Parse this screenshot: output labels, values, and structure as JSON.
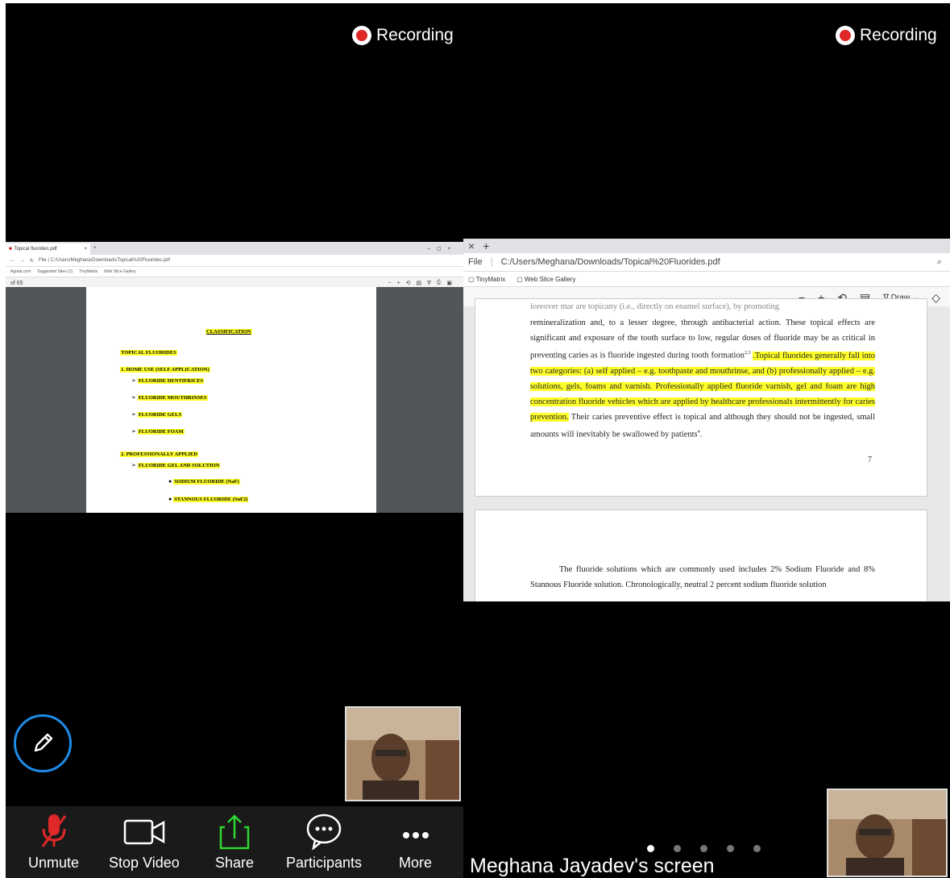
{
  "recording_label": "Recording",
  "left": {
    "browser": {
      "tab_title": "Topical fluorides.pdf",
      "address": "File | C:/Users/Meghana/Downloads/Topical%20Fluorides.pdf",
      "bookmarks": [
        "Agoda.com",
        "Suggested Sites (1)",
        "TinyMatrix",
        "Web Slice Gallery"
      ],
      "page_indicator": "of 65"
    },
    "doc_lines": [
      "CLASSIFICATION",
      "TOPICAL FLUORIDES",
      "1. HOME USE (SELF APPLICATION)",
      "FLUORIDE DENTIFRICES",
      "FLUORIDE MOUTHRINSES",
      "FLUORIDE GELS",
      "FLUORIDE FOAM",
      "2. PROFESSIONALLY APPLIED",
      "FLUORIDE GEL AND SOLUTION",
      "SODIUM FLUORIDE (NaF)",
      "STANNOUS FLUORIDE (SnF2)"
    ],
    "controls": {
      "unmute": "Unmute",
      "stop_video": "Stop Video",
      "share": "Share",
      "participants": "Participants",
      "more": "More"
    }
  },
  "right": {
    "browser": {
      "address_prefix": "File",
      "address": "C:/Users/Meghana/Downloads/Topical%20Fluorides.pdf",
      "bookmarks": [
        "TinyMatrix",
        "Web Slice Gallery"
      ],
      "draw_label": "Draw"
    },
    "page1": {
      "line0": "ioreover mar are topicany (i.e., directly on enamel surface), by promoting",
      "plain1": "remineralization and, to a lesser degree, through antibacterial action. These topical effects are significant and exposure of the tooth surface to low, regular doses of fluoride may be as critical in preventing caries as is fluoride ingested during tooth formation",
      "sup1": "2,3",
      "space": " ",
      "hl": ".Topical fluorides generally fall into two categories: (a) self applied – e.g. toothpaste and mouthrinse, and (b) professionally applied – e.g. solutions, gels, foams and varnish. Professionally applied fluoride varnish, gel and foam are high concentration fluoride vehicles which are applied by healthcare professionals intermittently for caries prevention.",
      "plain2": " Their caries preventive effect is topical and although they should not be ingested, small amounts will inevitably be swallowed by patients",
      "sup2": "4",
      "end": ".",
      "page_number": "7"
    },
    "page2": {
      "text": "The fluoride solutions which are commonly used includes 2% Sodium Fluoride and 8% Stannous Fluoride solution. Chronologically, neutral 2 percent sodium fluoride solution"
    },
    "screen_owner": "Meghana Jayadev's screen"
  },
  "colors": {
    "accent": "#1f8ae8",
    "record": "#e02828",
    "share": "#2fd62f",
    "highlight": "#ffff2a"
  }
}
